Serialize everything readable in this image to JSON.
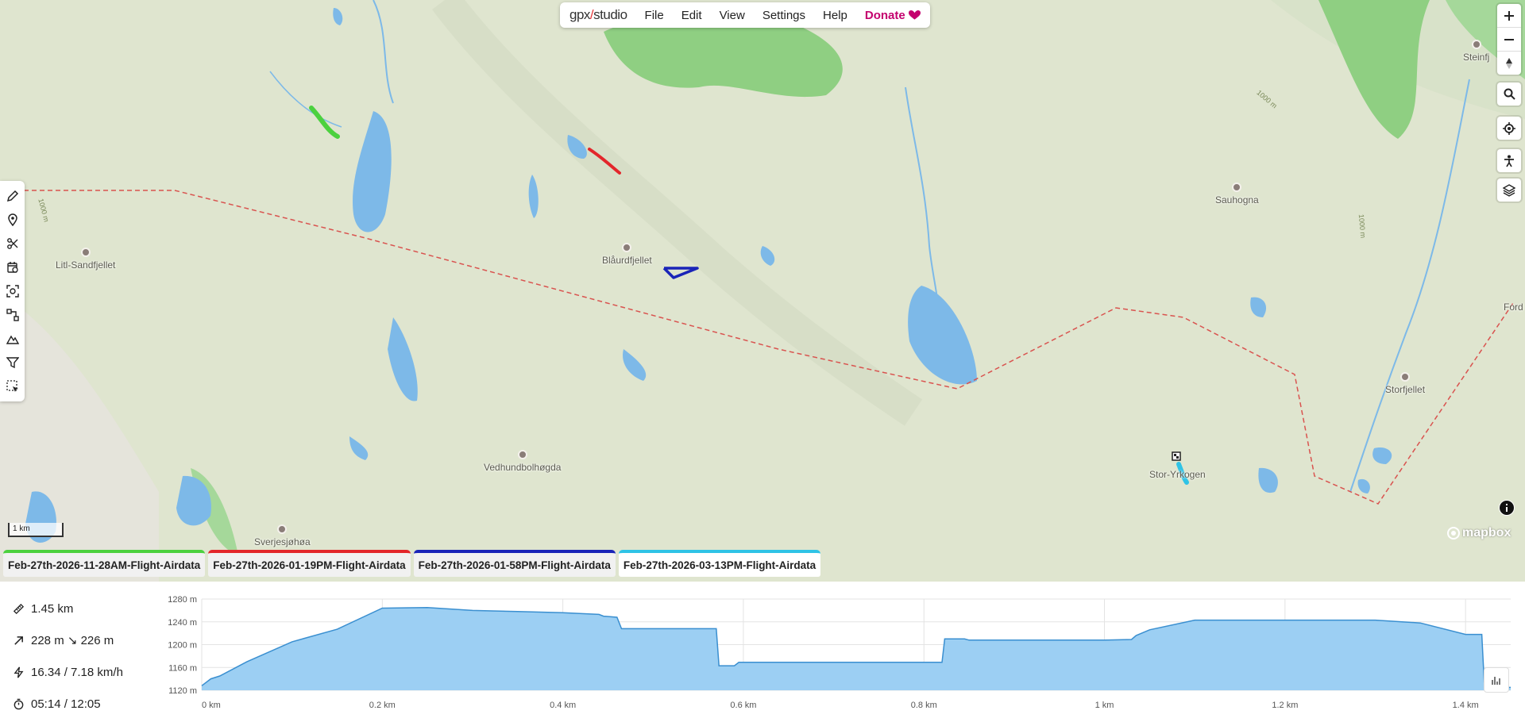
{
  "app": {
    "logo_left": "gpx",
    "logo_right": "studio"
  },
  "menu": [
    "File",
    "Edit",
    "View",
    "Settings",
    "Help"
  ],
  "donate": "Donate",
  "places": {
    "litl_sandfjellet": "Litl-Sandfjellet",
    "blaurdfjellet": "Blåurdfjellet",
    "sauhogna": "Sauhogna",
    "storfjellet": "Storfjellet",
    "vedhundbolhogda": "Vedhundbolhøgda",
    "sverjesjohoa": "Sverjesjøhøa",
    "stor_yrkogen": "Stor-Yrkogen",
    "steinfj": "Steinfj",
    "ford": "Ford"
  },
  "contours": {
    "a": "1000 m",
    "b": "1000 m",
    "c": "1000 m"
  },
  "scale": "1 km",
  "attribution": "mapbox",
  "tabs": [
    {
      "label": "Feb-27th-2026-11-28AM-Flight-Airdata",
      "color": "#4cd13f"
    },
    {
      "label": "Feb-27th-2026-01-19PM-Flight-Airdata",
      "color": "#e3262b"
    },
    {
      "label": "Feb-27th-2026-01-58PM-Flight-Airdata",
      "color": "#1a24b8"
    },
    {
      "label": "Feb-27th-2026-03-13PM-Flight-Airdata",
      "color": "#2fc3e6"
    }
  ],
  "active_tab": 3,
  "stats": {
    "distance": "1.45 km",
    "elevation": "228 m ↘ 226 m",
    "speed": "16.34 / 7.18 km/h",
    "time": "05:14 / 12:05"
  },
  "elevation_chart": {
    "y_labels": [
      "1280 m",
      "1240 m",
      "1200 m",
      "1160 m",
      "1120 m"
    ],
    "x_labels": [
      "0 km",
      "0.2 km",
      "0.4 km",
      "0.6 km",
      "0.8 km",
      "1 km",
      "1.2 km",
      "1.4 km"
    ]
  },
  "chart_data": {
    "type": "area",
    "xlabel": "",
    "ylabel": "",
    "x_unit": "km",
    "y_unit": "m",
    "xlim": [
      0,
      1.45
    ],
    "ylim": [
      1120,
      1280
    ],
    "x": [
      0,
      0.01,
      0.02,
      0.05,
      0.1,
      0.15,
      0.2,
      0.25,
      0.3,
      0.35,
      0.4,
      0.44,
      0.445,
      0.46,
      0.465,
      0.57,
      0.573,
      0.59,
      0.595,
      0.82,
      0.823,
      0.845,
      0.85,
      1.0,
      1.03,
      1.035,
      1.05,
      1.1,
      1.2,
      1.3,
      1.35,
      1.4,
      1.418,
      1.421,
      1.45
    ],
    "y": [
      1128,
      1140,
      1145,
      1170,
      1205,
      1227,
      1264,
      1265,
      1260,
      1258,
      1256,
      1253,
      1250,
      1248,
      1228,
      1228,
      1163,
      1163,
      1169,
      1169,
      1210,
      1210,
      1208,
      1208,
      1209,
      1216,
      1226,
      1243,
      1243,
      1243,
      1238,
      1218,
      1218,
      1125,
      1125
    ]
  },
  "colors": {
    "water": "#7db9e8",
    "forest": "#8fcf82",
    "border": "#d9534f"
  }
}
